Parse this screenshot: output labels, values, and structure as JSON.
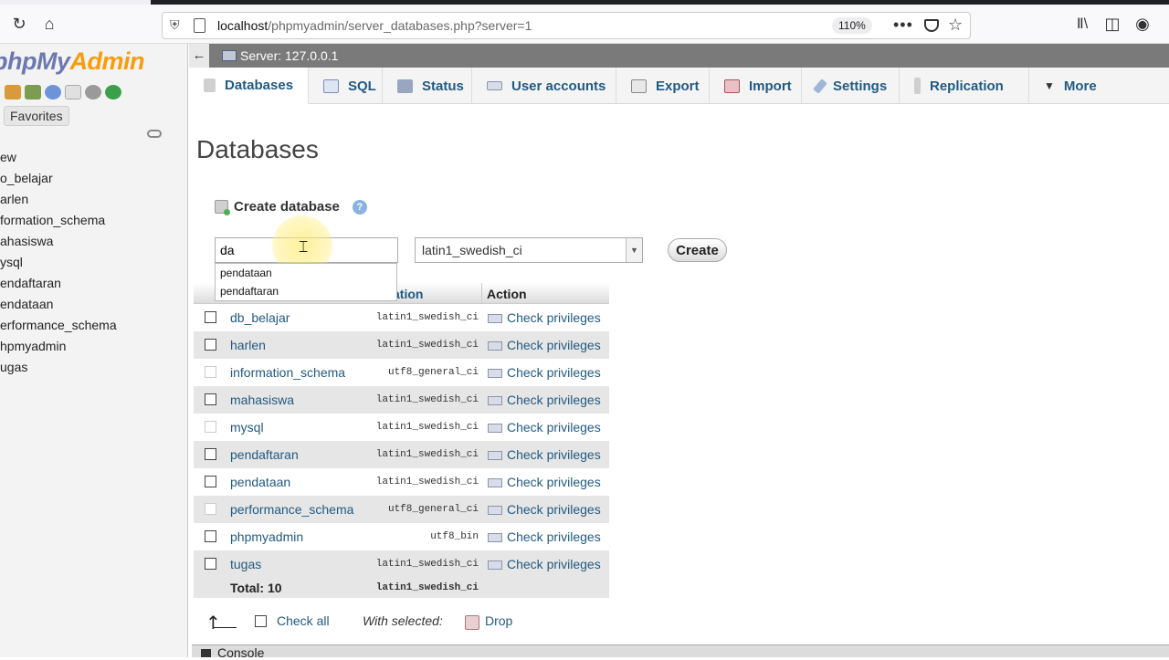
{
  "browser": {
    "url_host": "localhost",
    "url_path": "/phpmyadmin/server_databases.php?server=1",
    "zoom": "110%"
  },
  "logo": {
    "part1": "phpMy",
    "part2": "Admin"
  },
  "sidebar": {
    "favorites_label": "Favorites",
    "items": [
      "ew",
      "o_belajar",
      "arlen",
      "formation_schema",
      "ahasiswa",
      "ysql",
      "endaftaran",
      "endataan",
      "erformance_schema",
      "hpmyadmin",
      "ugas"
    ]
  },
  "server_bar": {
    "label": "Server: 127.0.0.1"
  },
  "tabs": [
    {
      "label": "Databases"
    },
    {
      "label": "SQL"
    },
    {
      "label": "Status"
    },
    {
      "label": "User accounts"
    },
    {
      "label": "Export"
    },
    {
      "label": "Import"
    },
    {
      "label": "Settings"
    },
    {
      "label": "Replication"
    },
    {
      "label": "More"
    }
  ],
  "page_title": "Databases",
  "create": {
    "title": "Create database",
    "input_value": "da",
    "collation": "latin1_swedish_ci",
    "button": "Create",
    "autocomplete": [
      "pendataan",
      "pendaftaran"
    ]
  },
  "table": {
    "header_collation_fragment": "ation",
    "header_action": "Action",
    "privilege_label": "Check privileges",
    "rows": [
      {
        "name": "db_belajar",
        "collation": "latin1_swedish_ci"
      },
      {
        "name": "harlen",
        "collation": "latin1_swedish_ci"
      },
      {
        "name": "information_schema",
        "collation": "utf8_general_ci"
      },
      {
        "name": "mahasiswa",
        "collation": "latin1_swedish_ci"
      },
      {
        "name": "mysql",
        "collation": "latin1_swedish_ci"
      },
      {
        "name": "pendaftaran",
        "collation": "latin1_swedish_ci"
      },
      {
        "name": "pendataan",
        "collation": "latin1_swedish_ci"
      },
      {
        "name": "performance_schema",
        "collation": "utf8_general_ci"
      },
      {
        "name": "phpmyadmin",
        "collation": "utf8_bin"
      },
      {
        "name": "tugas",
        "collation": "latin1_swedish_ci"
      }
    ],
    "total_label": "Total: 10",
    "total_collation": "latin1_swedish_ci"
  },
  "footer": {
    "check_all": "Check all",
    "with_selected": "With selected:",
    "drop": "Drop"
  },
  "console": {
    "label": "Console"
  }
}
